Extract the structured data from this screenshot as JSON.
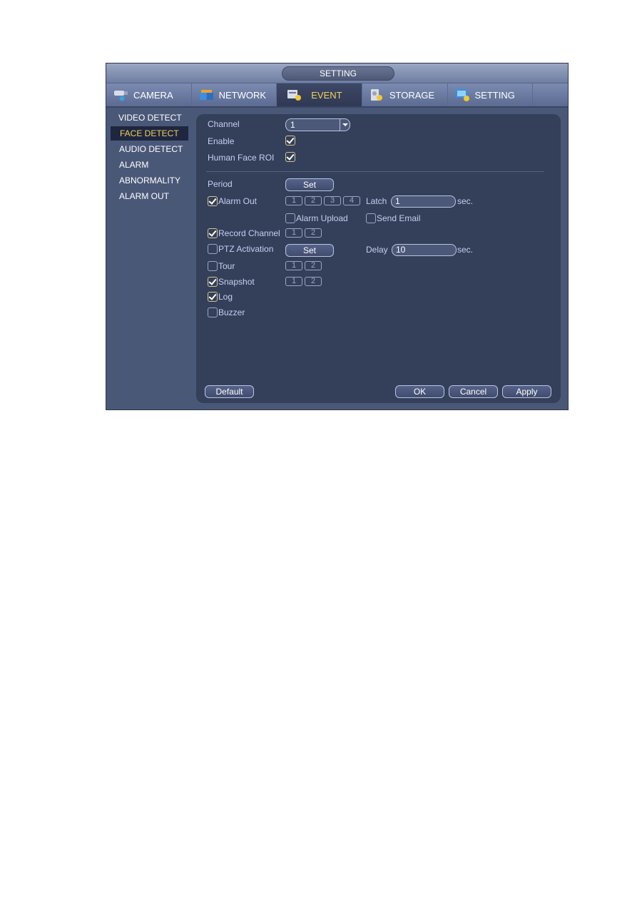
{
  "window": {
    "title": "SETTING"
  },
  "tabs": [
    {
      "label": "CAMERA",
      "icon": "camera-icon",
      "active": false
    },
    {
      "label": "NETWORK",
      "icon": "network-icon",
      "active": false
    },
    {
      "label": "EVENT",
      "icon": "event-icon",
      "active": true
    },
    {
      "label": "STORAGE",
      "icon": "storage-icon",
      "active": false
    },
    {
      "label": "SETTING",
      "icon": "setting-icon",
      "active": false
    }
  ],
  "sidebar": {
    "items": [
      {
        "label": "VIDEO DETECT",
        "active": false
      },
      {
        "label": "FACE DETECT",
        "active": true
      },
      {
        "label": "AUDIO DETECT",
        "active": false
      },
      {
        "label": "ALARM",
        "active": false
      },
      {
        "label": "ABNORMALITY",
        "active": false
      },
      {
        "label": "ALARM OUT",
        "active": false
      }
    ]
  },
  "form": {
    "channel": {
      "label": "Channel",
      "value": "1"
    },
    "enable": {
      "label": "Enable",
      "checked": true
    },
    "human_face_roi": {
      "label": "Human Face ROI",
      "checked": true
    },
    "period": {
      "label": "Period",
      "button": "Set"
    },
    "alarm_out": {
      "label": "Alarm Out",
      "checked": true,
      "channels": [
        "1",
        "2",
        "3",
        "4"
      ],
      "latch_label": "Latch",
      "latch_value": "1",
      "latch_unit": "sec."
    },
    "alarm_upload": {
      "label": "Alarm Upload",
      "checked": false
    },
    "send_email": {
      "label": "Send Email",
      "checked": false
    },
    "record_channel": {
      "label": "Record Channel",
      "checked": true,
      "channels": [
        "1",
        "2"
      ]
    },
    "ptz_activation": {
      "label": "PTZ Activation",
      "checked": false,
      "button": "Set",
      "delay_label": "Delay",
      "delay_value": "10",
      "delay_unit": "sec."
    },
    "tour": {
      "label": "Tour",
      "checked": false,
      "channels": [
        "1",
        "2"
      ]
    },
    "snapshot": {
      "label": "Snapshot",
      "checked": true,
      "channels": [
        "1",
        "2"
      ]
    },
    "log": {
      "label": "Log",
      "checked": true
    },
    "buzzer": {
      "label": "Buzzer",
      "checked": false
    }
  },
  "buttons": {
    "default": "Default",
    "ok": "OK",
    "cancel": "Cancel",
    "apply": "Apply"
  },
  "colors": {
    "accent": "#f2d25a",
    "panel": "#34405a",
    "frame": "#4a5878",
    "label": "#c5cff2"
  }
}
